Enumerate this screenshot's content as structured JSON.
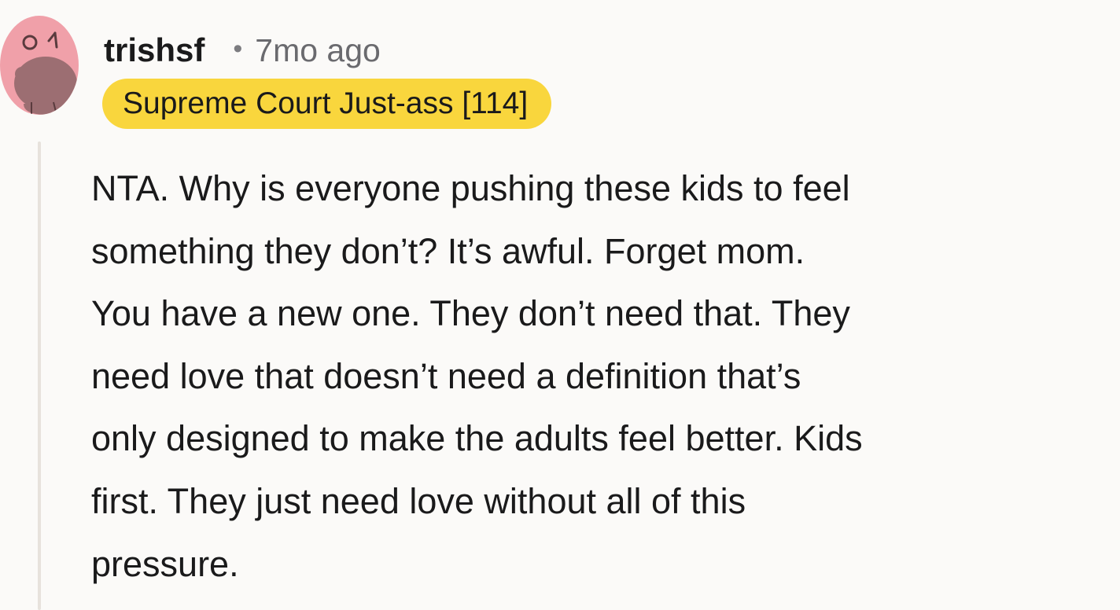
{
  "comment": {
    "author": "trishsf",
    "separator": "•",
    "timestamp": "7mo ago",
    "flair": "Supreme Court Just-ass [114]",
    "body_lines": [
      "NTA. Why is everyone pushing these kids to feel",
      "something they don’t? It’s awful. Forget mom.",
      "You have a new one. They don’t need that. They",
      "need love that doesn’t need a definition that’s",
      "only designed to make the adults feel better. Kids",
      "first. They just need love without all of this",
      "pressure."
    ]
  },
  "avatar": {
    "icon": "reddit-snoo-avatar-icon",
    "background_color": "#f0a0a9",
    "figure_color": "#9c6e72"
  },
  "colors": {
    "flair_background": "#f9d63d",
    "page_background": "#fbfaf8",
    "thread_line": "#e7e2dc",
    "text": "#1a1a1b",
    "muted_text": "#6a6a6e"
  }
}
